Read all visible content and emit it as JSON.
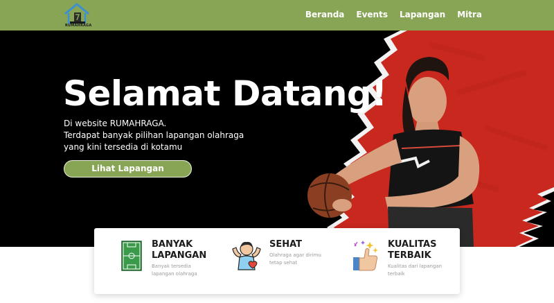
{
  "brand": {
    "name": "RUMAHRAGA"
  },
  "nav": {
    "items": [
      {
        "label": "Beranda"
      },
      {
        "label": "Events"
      },
      {
        "label": "Lapangan"
      },
      {
        "label": "Mitra"
      }
    ]
  },
  "hero": {
    "title": "Selamat Datang!",
    "lines": [
      "Di website RUMAHRAGA.",
      "Terdapat banyak pilihan lapangan olahraga",
      "yang kini tersedia di kotamu"
    ],
    "button_label": "Lihat Lapangan"
  },
  "features": [
    {
      "icon": "soccer-field-icon",
      "title_lines": [
        "BANYAK",
        "LAPANGAN"
      ],
      "desc_lines": [
        "Banyak tersedia",
        "lapangan olahraga"
      ]
    },
    {
      "icon": "healthy-person-icon",
      "title_lines": [
        "SEHAT"
      ],
      "desc_lines": [
        "Olahraga agar dirimu",
        "tetap sehat"
      ]
    },
    {
      "icon": "thumbs-up-icon",
      "title_lines": [
        "KUALITAS",
        "TERBAIK"
      ],
      "desc_lines": [
        "Kualitas dari lapangan",
        "terbaik"
      ]
    }
  ],
  "colors": {
    "accent": "#88a556",
    "hero_bg": "#000000",
    "hero_red": "#c8281e"
  }
}
